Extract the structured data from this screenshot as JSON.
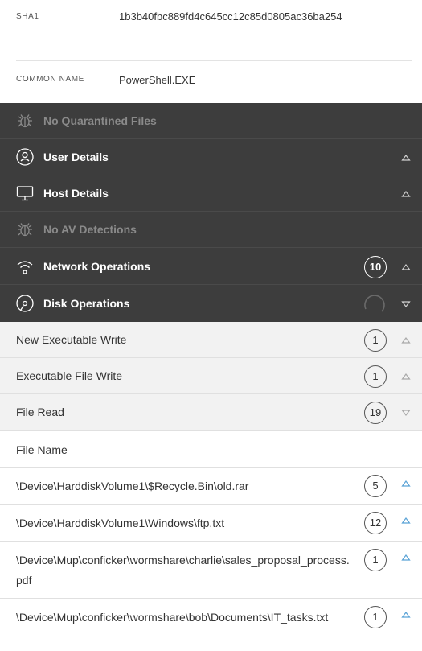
{
  "info": {
    "sha1_label": "SHA1",
    "sha1_value": "1b3b40fbc889fd4c645cc12c85d0805ac36ba254",
    "common_name_label": "COMMON NAME",
    "common_name_value": "PowerShell.EXE"
  },
  "sections": {
    "quarantined": {
      "label": "No Quarantined Files",
      "icon": "bug-icon"
    },
    "user_details": {
      "label": "User Details",
      "icon": "user-circle-icon"
    },
    "host_details": {
      "label": "Host Details",
      "icon": "monitor-icon"
    },
    "av_detections": {
      "label": "No AV Detections",
      "icon": "bug-icon"
    },
    "network_ops": {
      "label": "Network Operations",
      "count": "10",
      "icon": "wifi-icon"
    },
    "disk_ops": {
      "label": "Disk Operations",
      "icon": "disk-icon"
    }
  },
  "disk_subsections": [
    {
      "label": "New Executable Write",
      "count": "1"
    },
    {
      "label": "Executable File Write",
      "count": "1"
    },
    {
      "label": "File Read",
      "count": "19"
    }
  ],
  "file_table": {
    "header": "File Name",
    "rows": [
      {
        "name": "\\Device\\HarddiskVolume1\\$Recycle.Bin\\old.rar",
        "count": "5"
      },
      {
        "name": "\\Device\\HarddiskVolume1\\Windows\\ftp.txt",
        "count": "12"
      },
      {
        "name": "\\Device\\Mup\\conficker\\wormshare\\charlie\\sales_proposal_process.pdf",
        "count": "1"
      },
      {
        "name": "\\Device\\Mup\\conficker\\wormshare\\bob\\Documents\\IT_tasks.txt",
        "count": "1"
      }
    ]
  },
  "colors": {
    "dark_bg": "#3d3d3d",
    "light_bg": "#f2f2f2",
    "accent_caret": "#5ba3d6"
  }
}
